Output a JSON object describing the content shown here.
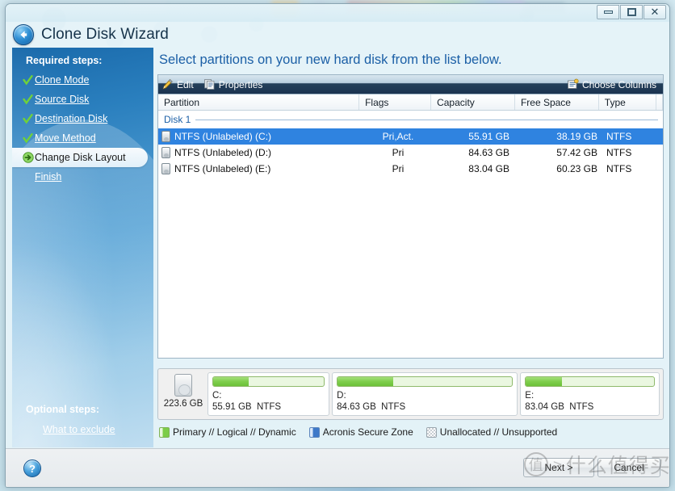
{
  "window": {
    "title": "Clone Disk Wizard",
    "controls": [
      {
        "name": "minimize",
        "label": "–"
      },
      {
        "name": "maximize",
        "label": "□"
      },
      {
        "name": "close",
        "label": "✕"
      }
    ],
    "back_icon": "back-arrow-icon"
  },
  "sidebar": {
    "required_label": "Required steps:",
    "steps": [
      {
        "label": "Clone Mode",
        "state": "done"
      },
      {
        "label": "Source Disk",
        "state": "done"
      },
      {
        "label": "Destination Disk",
        "state": "done"
      },
      {
        "label": "Move Method",
        "state": "done"
      },
      {
        "label": "Change Disk Layout",
        "state": "current"
      },
      {
        "label": "Finish",
        "state": "pending"
      }
    ],
    "optional_label": "Optional steps:",
    "optional_link": "What to exclude"
  },
  "main": {
    "page_title": "Select partitions on your new hard disk from the list below.",
    "toolbar": {
      "edit": "Edit",
      "properties": "Properties",
      "choose_columns": "Choose Columns"
    },
    "columns": [
      "Partition",
      "Flags",
      "Capacity",
      "Free Space",
      "Type"
    ],
    "disk_group_label": "Disk 1",
    "rows": [
      {
        "partition": "NTFS (Unlabeled) (C:)",
        "flags": "Pri,Act.",
        "capacity": "55.91 GB",
        "free": "38.19 GB",
        "type": "NTFS",
        "selected": true
      },
      {
        "partition": "NTFS (Unlabeled) (D:)",
        "flags": "Pri",
        "capacity": "84.63 GB",
        "free": "57.42 GB",
        "type": "NTFS",
        "selected": false
      },
      {
        "partition": "NTFS (Unlabeled) (E:)",
        "flags": "Pri",
        "capacity": "83.04 GB",
        "free": "60.23 GB",
        "type": "NTFS",
        "selected": false
      }
    ],
    "disk_map": {
      "disk_capacity": "223.6 GB",
      "partitions": [
        {
          "letter": "C:",
          "size": "55.91 GB",
          "fs": "NTFS",
          "used_percent": 32,
          "width_percent": 24.5
        },
        {
          "letter": "D:",
          "size": "84.63 GB",
          "fs": "NTFS",
          "used_percent": 32,
          "width_percent": 37.3
        },
        {
          "letter": "E:",
          "size": "83.04 GB",
          "fs": "NTFS",
          "used_percent": 28,
          "width_percent": 38.2
        }
      ]
    },
    "legend": [
      {
        "swatch": "green",
        "label": "Primary // Logical // Dynamic"
      },
      {
        "swatch": "blue",
        "label": "Acronis Secure Zone"
      },
      {
        "swatch": "gray",
        "label": "Unallocated // Unsupported"
      }
    ]
  },
  "bottom": {
    "help_label": "?",
    "next_label": "Next >",
    "cancel_label": "Cancel",
    "watermark": {
      "badge": "值",
      "gt": ">",
      "text": "什么值得买"
    }
  },
  "colors": {
    "accent_blue": "#1b5fa6",
    "selection_blue": "#2f83e0",
    "sidebar_blue": "#2a7fbe",
    "partition_green": "#7fce4d"
  }
}
